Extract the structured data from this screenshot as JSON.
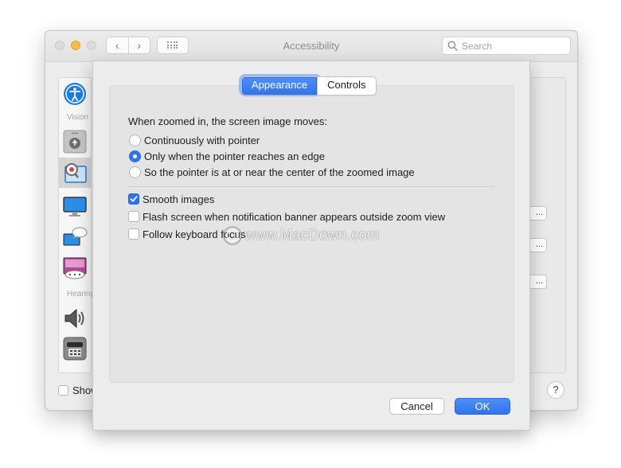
{
  "window": {
    "title": "Accessibility",
    "search_placeholder": "Search",
    "nav_back_glyph": "‹",
    "nav_forward_glyph": "›"
  },
  "sidebar": {
    "section_vision": "Vision",
    "section_hearing": "Hearing",
    "items": [
      {
        "icon": "accessibility-icon"
      },
      {
        "icon": "voiceover-icon"
      },
      {
        "icon": "zoom-icon",
        "selected": true
      },
      {
        "icon": "display-icon"
      },
      {
        "icon": "speech-icon"
      },
      {
        "icon": "descriptions-icon"
      },
      {
        "icon": "audio-icon"
      },
      {
        "icon": "rtt-icon"
      }
    ]
  },
  "background": {
    "show_label": "Show",
    "help": "?",
    "ellipsis_buttons": [
      "...",
      "...",
      "..."
    ]
  },
  "sheet": {
    "tabs": [
      {
        "label": "Appearance",
        "active": true
      },
      {
        "label": "Controls",
        "active": false
      }
    ],
    "moves_heading": "When zoomed in, the screen image moves:",
    "radio_options": [
      {
        "label": "Continuously with pointer",
        "selected": false
      },
      {
        "label": "Only when the pointer reaches an edge",
        "selected": true
      },
      {
        "label": "So the pointer is at or near the center of the zoomed image",
        "selected": false
      }
    ],
    "checkboxes": [
      {
        "label": "Smooth images",
        "checked": true
      },
      {
        "label": "Flash screen when notification banner appears outside zoom view",
        "checked": false
      },
      {
        "label": "Follow keyboard focus",
        "checked": false
      }
    ],
    "watermark": "www.MacDown.com",
    "cancel_label": "Cancel",
    "ok_label": "OK"
  },
  "colors": {
    "accent": "#2f74ee",
    "minimize": "#f5be4f"
  }
}
